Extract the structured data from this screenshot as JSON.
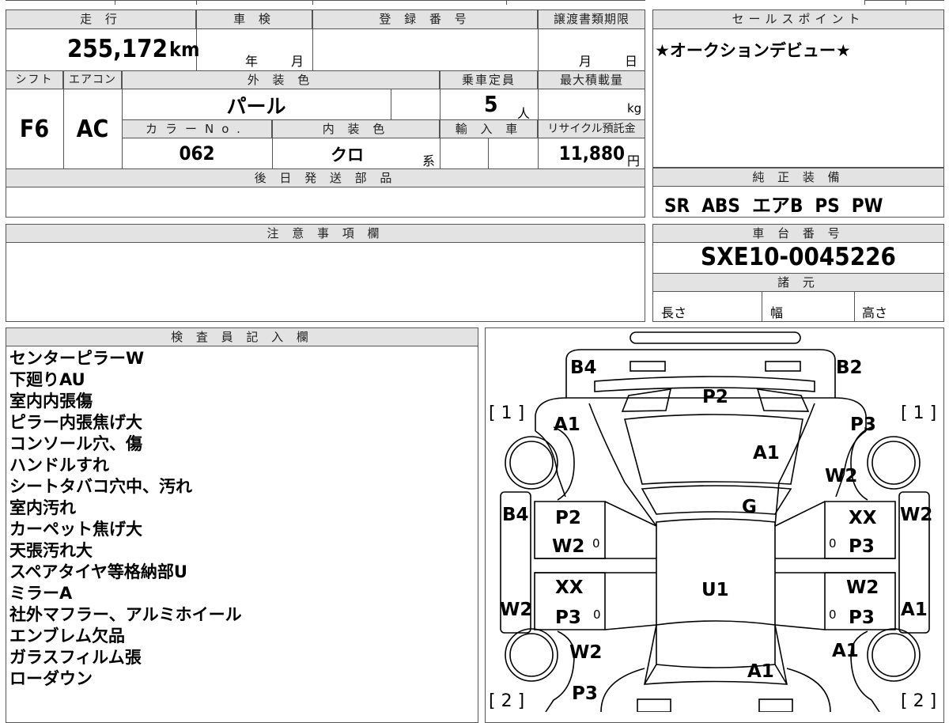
{
  "labels": {
    "mileage": "走 行",
    "shaken": "車 検",
    "registration": "登 録 番 号",
    "transfer_deadline": "譲渡書類期限",
    "sales_point": "セールスポイント",
    "shift": "シフト",
    "aircon": "エアコン",
    "exterior_color": "外 装 色",
    "capacity": "乗車定員",
    "max_load": "最大積載量",
    "color_no": "カラーNo.",
    "interior_color": "内 装 色",
    "import": "輸 入 車",
    "recycle": "リサイクル預託金",
    "later_parts": "後 日 発 送 部 品",
    "standard_equipment": "純 正 装 備",
    "caution": "注 意 事 項 欄",
    "chassis_no": "車 台 番 号",
    "specs": "諸 元",
    "inspector": "検 査 員 記 入 欄"
  },
  "values": {
    "mileage": "255,172",
    "mileage_unit": "km",
    "year": "年",
    "month": "月",
    "deadline_month": "月",
    "deadline_day": "日",
    "sales_point": "★オークションデビュー★",
    "shift": "F6",
    "aircon": "AC",
    "exterior_color": "パール",
    "capacity": "5",
    "capacity_unit": "人",
    "max_load_unit": "kg",
    "color_no": "062",
    "interior_color": "クロ",
    "interior_suffix": "系",
    "recycle": "11,880",
    "recycle_unit": "円",
    "equipment": "SR  ABS  エアB  PS  PW",
    "chassis_no": "SXE10-0045226",
    "length_label": "長さ",
    "width_label": "幅",
    "height_label": "高さ"
  },
  "inspector_notes": [
    "センターピラーW",
    "下廻りAU",
    "室内内張傷",
    "ピラー内張焦げ大",
    "コンソール穴、傷",
    "ハンドルすれ",
    "シートタバコ穴中、汚れ",
    "室内汚れ",
    "カーペット焦げ大",
    "天張汚れ大",
    "スペアタイヤ等格納部U",
    "ミラーA",
    "社外マフラー、アルミホイール",
    "エンブレム欠品",
    "ガラスフィルム張",
    "ローダウン"
  ],
  "diagram": {
    "b4_rear": "B4",
    "b2_rear": "B2",
    "p2_top": "P2",
    "bracket1_left": "[ 1 ]",
    "bracket1_right": "[ 1 ]",
    "a1_left": "A1",
    "p3_right_top": "P3",
    "a1_roof": "A1",
    "w2_right_top": "W2",
    "g_glass": "G",
    "b4_side": "B4",
    "p2_left_door": "P2",
    "w2_left_door": "W2",
    "zero1": "0",
    "xx_right_door": "XX",
    "w2_side_right": "W2",
    "zero2": "0",
    "p3_right_door": "P3",
    "xx_left_door2": "XX",
    "u1": "U1",
    "w2_right_door2": "W2",
    "w2_side_left": "W2",
    "p3_left_door2": "P3",
    "zero3": "0",
    "zero4": "0",
    "p3_right_door2": "P3",
    "a1_side_right": "A1",
    "w2_left_front": "W2",
    "a1_right_front": "A1",
    "a1_hood": "A1",
    "p3_front": "P3",
    "bracket2_left": "[ 2 ]",
    "bracket2_right": "[ 2 ]"
  }
}
